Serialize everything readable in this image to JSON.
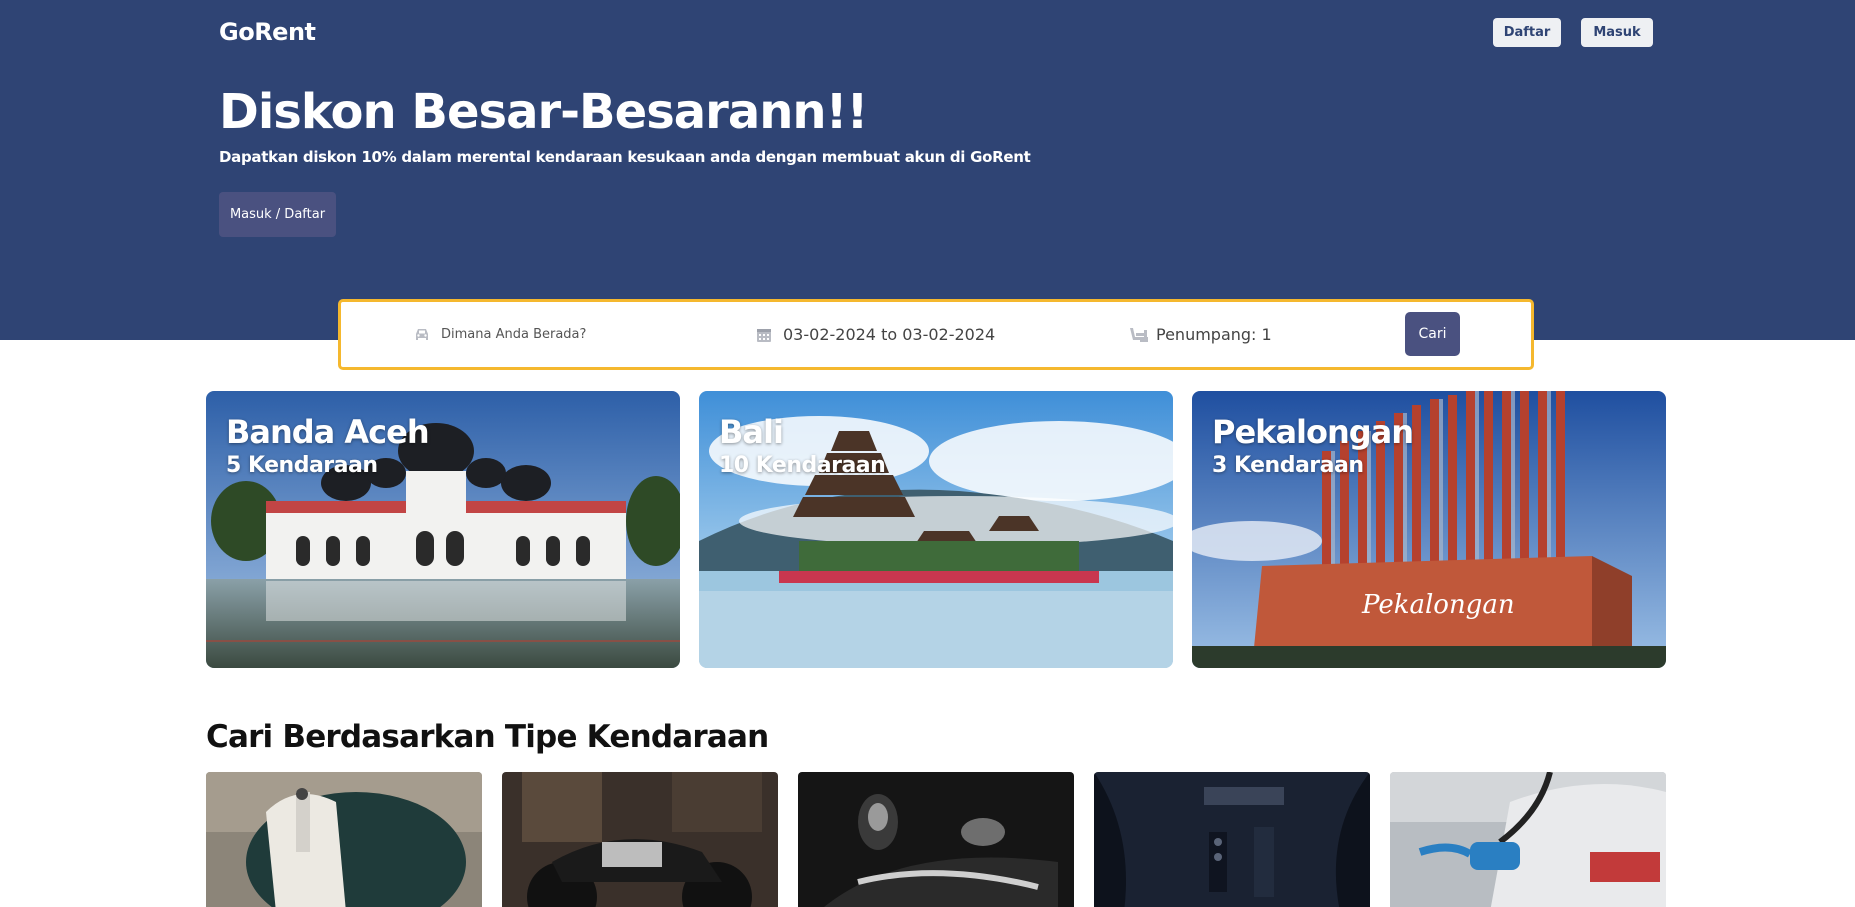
{
  "header": {
    "logo": "GoRent",
    "register_label": "Daftar",
    "login_label": "Masuk"
  },
  "hero": {
    "title": "Diskon Besar-Besarann!!",
    "subtitle": "Dapatkan diskon 10% dalam merental kendaraan kesukaan anda dengan membuat akun di GoRent",
    "cta_label": "Masuk / Daftar"
  },
  "search": {
    "location_placeholder": "Dimana Anda Berada?",
    "date_range": "03-02-2024 to 03-02-2024",
    "passengers": "Penumpang: 1",
    "submit_label": "Cari",
    "icons": [
      "car-icon",
      "calendar-icon",
      "seat-icon"
    ],
    "border_color": "#f5b82e"
  },
  "cities": [
    {
      "name": "Banda Aceh",
      "count": "5 Kendaraan"
    },
    {
      "name": "Bali",
      "count": "10 Kendaraan"
    },
    {
      "name": "Pekalongan",
      "count": "3 Kendaraan"
    }
  ],
  "vehicle_types": {
    "title": "Cari Berdasarkan Tipe Kendaraan",
    "items": [
      "scooter-image",
      "motorcycle-image",
      "gear-shift-image",
      "car-interior-image",
      "ev-charging-image"
    ]
  },
  "colors": {
    "hero_bg": "#2f4474",
    "button_bg": "#4a5180",
    "accent": "#f5b82e"
  }
}
